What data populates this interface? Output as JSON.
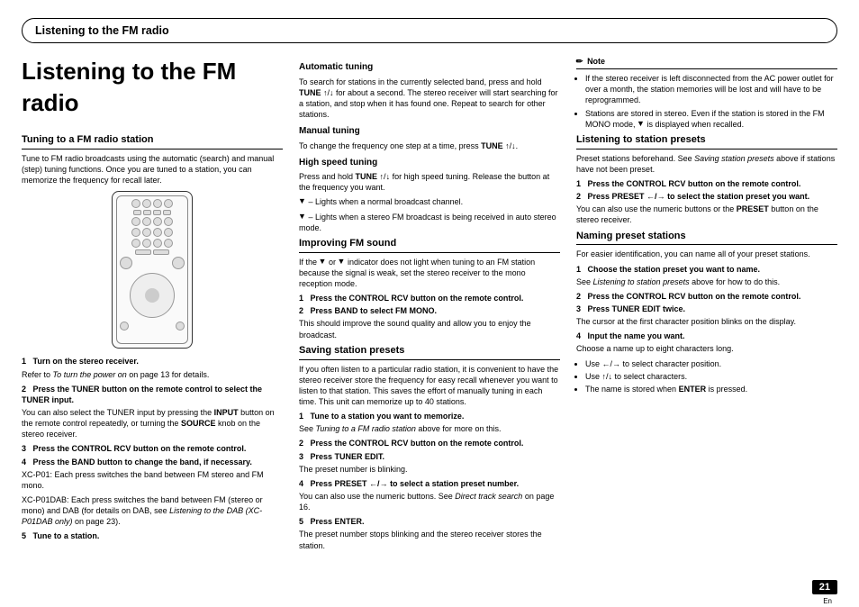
{
  "header": {
    "running_title": "Listening to the FM radio"
  },
  "title": "Listening to the FM radio",
  "page_number": "21",
  "page_lang": "En",
  "col1": {
    "h1": "Tuning to a FM radio station",
    "intro": "Tune to FM radio broadcasts using the automatic (search) and manual (step) tuning functions. Once you are tuned to a station, you can memorize the frequency for recall later.",
    "steps": {
      "s1": "Turn on the stereo receiver.",
      "s1_after_a": "Refer to ",
      "s1_after_i": "To turn the power on",
      "s1_after_b": " on page 13 for details.",
      "s2": "Press the TUNER button on the remote control to select the TUNER input.",
      "s2_after_a": "You can also select the TUNER input by pressing the ",
      "s2_after_b": "INPUT",
      "s2_after_c": " button on the remote control repeatedly, or turning the ",
      "s2_after_d": "SOURCE",
      "s2_after_e": " knob on the stereo receiver.",
      "s3": "Press the CONTROL RCV button on the remote control.",
      "s4": "Press the BAND button to change the band, if necessary.",
      "s4_after_a": "XC-P01: Each press switches the band between FM stereo and FM mono.",
      "s4_after_b1": "XC-P01DAB: Each press switches the band between FM (stereo or mono) and DAB (for details on DAB, see ",
      "s4_after_b2": "Listening to the DAB (XC-P01DAB only)",
      "s4_after_b3": " on page 23).",
      "s5": "Tune to a station."
    }
  },
  "col2": {
    "auto_h": "Automatic tuning",
    "auto_p_a": "To search for stations in the currently selected band, press and hold ",
    "auto_p_b": "TUNE ",
    "auto_p_c": " for about a second. The stereo receiver will start searching for a station, and stop when it has found one. Repeat to search for other stations.",
    "manual_h": "Manual tuning",
    "manual_p_a": "To change the frequency one step at a time, press ",
    "manual_p_b": "TUNE ",
    "hs_h": "High speed tuning",
    "hs_p_a": "Press and hold ",
    "hs_p_b": "TUNE ",
    "hs_p_c": " for high speed tuning. Release the button at the frequency you want.",
    "ind_a": " – Lights when a normal broadcast channel.",
    "ind_b": " – Lights when a stereo FM broadcast is being received in auto stereo mode.",
    "improve_h": "Improving FM sound",
    "improve_p": "If the  or  indicator does not light when tuning to an FM station because the signal is weak, set the stereo receiver to the mono reception mode.",
    "improve_s1": "Press the CONTROL RCV button on the remote control.",
    "improve_s2": "Press BAND to select FM MONO.",
    "improve_after": "This should improve the sound quality and allow you to enjoy the broadcast.",
    "save_h": "Saving station presets",
    "save_intro": "If you often listen to a particular radio station, it is convenient to have the stereo receiver store the frequency for easy recall whenever you want to listen to that station. This saves the effort of manually tuning in each time. This unit can memorize up to 40 stations.",
    "save_s1": "Tune to a station you want to memorize.",
    "save_s1_after_a": "See ",
    "save_s1_after_i": "Tuning to a FM radio station",
    "save_s1_after_b": " above for more on this.",
    "save_s2": "Press the CONTROL RCV button on the remote control.",
    "save_s3": "Press TUNER EDIT.",
    "save_s3_after": "The preset number is blinking.",
    "save_s4_a": "Press PRESET ",
    "save_s4_b": " to select a station preset number.",
    "save_s4_after_a": "You can also use the numeric buttons. See ",
    "save_s4_after_i": "Direct track search",
    "save_s4_after_b": " on page 16.",
    "save_s5": "Press ENTER.",
    "save_after": "The preset number stops blinking and the stereo receiver stores the station."
  },
  "col3": {
    "note_label": "Note",
    "note_b1": "If the stereo receiver is left disconnected from the AC power outlet for over a month, the station memories will be lost and will have to be reprogrammed.",
    "note_b2_a": "Stations are stored in stereo. Even if the station is stored in the FM MONO mode, ",
    "note_b2_b": " is displayed when recalled.",
    "listen_h": "Listening to station presets",
    "listen_intro_a": "Preset stations beforehand. See ",
    "listen_intro_i": "Saving station presets",
    "listen_intro_b": " above if stations have not been preset.",
    "listen_s1": "Press the CONTROL RCV button on the remote control.",
    "listen_s2_a": "Press PRESET ",
    "listen_s2_b": " to select the station preset you want.",
    "listen_after_a": "You can also use the numeric buttons or the ",
    "listen_after_b": "PRESET",
    "listen_after_c": " button on the stereo receiver.",
    "name_h": "Naming preset stations",
    "name_intro": "For easier identification, you can name all of your preset stations.",
    "name_s1": "Choose the station preset you want to name.",
    "name_s1_after_a": "See ",
    "name_s1_after_i": "Listening to station presets",
    "name_s1_after_b": " above for how to do this.",
    "name_s2": "Press the CONTROL RCV button on the remote control.",
    "name_s3": "Press TUNER EDIT twice.",
    "name_s3_after": "The cursor at the first character position blinks on the display.",
    "name_s4": "Input the name you want.",
    "name_s4_after": "Choose a name up to eight characters long.",
    "name_b1_a": "Use ",
    "name_b1_b": " to select character position.",
    "name_b2_a": "Use ",
    "name_b2_b": " to select characters.",
    "name_b3_a": "The name is stored when ",
    "name_b3_b": "ENTER",
    "name_b3_c": " is pressed."
  }
}
